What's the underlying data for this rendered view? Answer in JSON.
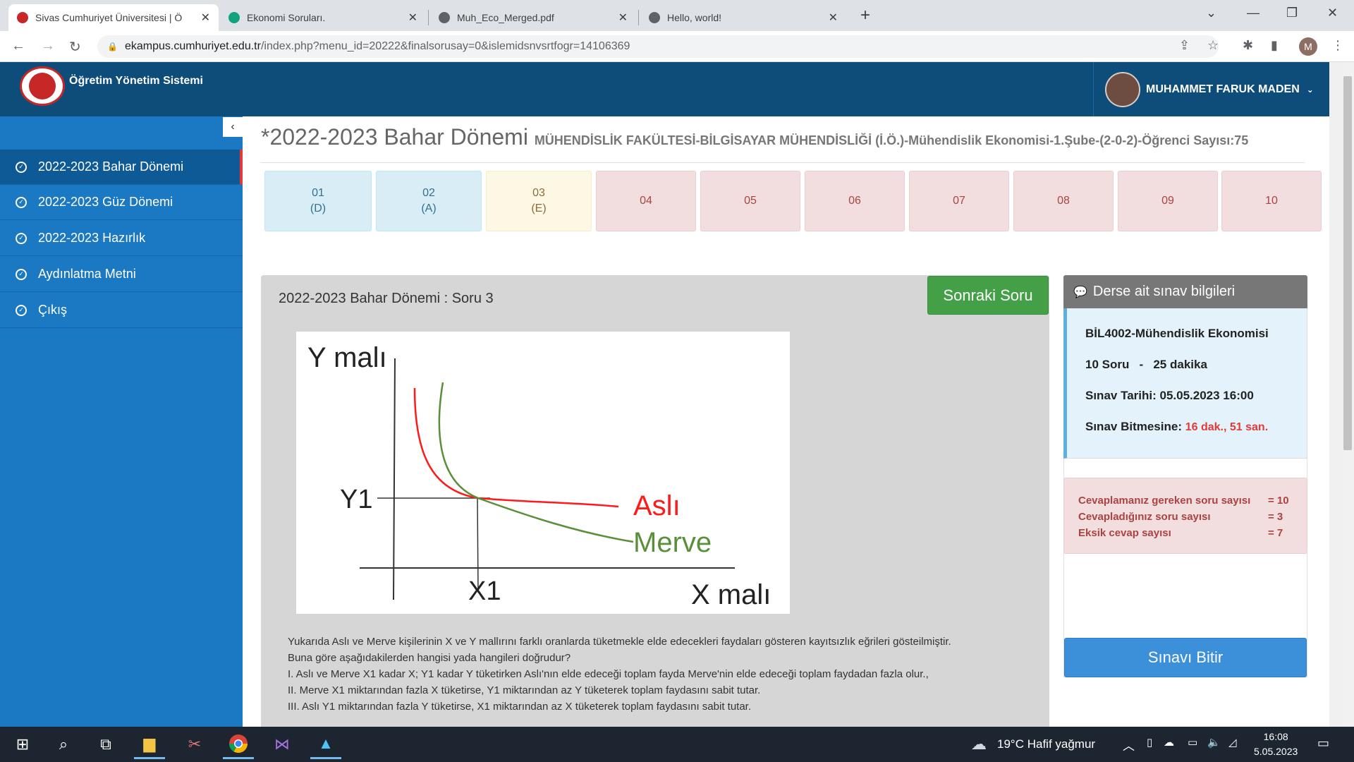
{
  "browser": {
    "tabs": [
      {
        "title": "Sivas Cumhuriyet Üniversitesi | Ö",
        "active": true,
        "favicon_color": "#c62828"
      },
      {
        "title": "Ekonomi Soruları.",
        "active": false,
        "favicon_color": "#10a37f"
      },
      {
        "title": "Muh_Eco_Merged.pdf",
        "active": false,
        "favicon_color": "#5f6368"
      },
      {
        "title": "Hello, world!",
        "active": false,
        "favicon_color": "#5f6368"
      }
    ],
    "url_host": "ekampus.cumhuriyet.edu.tr",
    "url_path": "/index.php?menu_id=20222&finalsorusay=0&islemidsnvsrtfogr=14106369",
    "profile_initial": "M"
  },
  "header": {
    "app_title": "Öğretim Yönetim Sistemi",
    "user_name": "MUHAMMET FARUK MADEN"
  },
  "sidebar": {
    "items": [
      {
        "label": "2022-2023 Bahar Dönemi",
        "active": true
      },
      {
        "label": "2022-2023 Güz Dönemi",
        "active": false
      },
      {
        "label": "2022-2023 Hazırlık",
        "active": false
      },
      {
        "label": "Aydınlatma Metni",
        "active": false
      },
      {
        "label": "Çıkış",
        "active": false
      }
    ]
  },
  "page": {
    "title": "*2022-2023 Bahar Dönemi",
    "subtitle": "MÜHENDİSLİK FAKÜLTESİ-BİLGİSAYAR MÜHENDİSLİĞİ (İ.Ö.)-Mühendislik Ekonomisi-1.Şube-(2-0-2)-Öğrenci Sayısı:75"
  },
  "question_nav": [
    {
      "num": "01",
      "answer": "(D)",
      "state": "answered"
    },
    {
      "num": "02",
      "answer": "(A)",
      "state": "answered"
    },
    {
      "num": "03",
      "answer": "(E)",
      "state": "current"
    },
    {
      "num": "04",
      "answer": "",
      "state": "pending"
    },
    {
      "num": "05",
      "answer": "",
      "state": "pending"
    },
    {
      "num": "06",
      "answer": "",
      "state": "pending"
    },
    {
      "num": "07",
      "answer": "",
      "state": "pending"
    },
    {
      "num": "08",
      "answer": "",
      "state": "pending"
    },
    {
      "num": "09",
      "answer": "",
      "state": "pending"
    },
    {
      "num": "10",
      "answer": "",
      "state": "pending"
    }
  ],
  "question": {
    "heading": "2022-2023 Bahar Dönemi : Soru 3",
    "next_label": "Sonraki Soru",
    "graph": {
      "y_axis_label": "Y malı",
      "x_axis_label": "X malı",
      "y_tick": "Y1",
      "x_tick": "X1",
      "curve_a_label": "Aslı",
      "curve_b_label": "Merve",
      "curve_a_color": "#ff1a1a",
      "curve_b_color": "#5a8f3a"
    },
    "lines": [
      "Yukarıda Aslı ve Merve kişilerinin X ve Y mallırını farklı oranlarda tüketmekle elde edecekleri faydaları gösteren kayıtsızlık eğrileri gösteilmiştir.",
      "Buna göre aşağıdakilerden hangisi yada hangileri doğrudur?",
      "I. Aslı ve Merve X1 kadar X; Y1 kadar Y tüketirken Aslı'nın elde edeceği toplam fayda Merve'nin elde edeceği toplam faydadan fazla olur.,",
      "II. Merve X1 miktarından fazla X tüketirse, Y1 miktarından az Y tüketerek toplam faydasını sabit tutar.",
      "III. Aslı Y1 miktarından fazla Y tüketirse, X1 miktarından  az X tüketerek toplam faydasını sabit tutar."
    ]
  },
  "exam_info": {
    "heading": "Derse ait sınav bilgileri",
    "course": "BİL4002-Mühendislik Ekonomisi",
    "summary": "10 Soru   -   25 dakika",
    "date_label": "Sınav Tarihi:",
    "date_value": "05.05.2023 16:00",
    "remaining_label": "Sınav Bitmesine:",
    "remaining_value": "16 dak., 51 san."
  },
  "counts": [
    {
      "label": "Cevaplamanız gereken soru sayısı",
      "value": "= 10"
    },
    {
      "label": "Cevapladığınız soru sayısı",
      "value": "= 3"
    },
    {
      "label": "Eksik cevap sayısı",
      "value": "= 7"
    }
  ],
  "finish_label": "Sınavı Bitir",
  "taskbar": {
    "weather": "19°C  Hafif yağmur",
    "time": "16:08",
    "date": "5.05.2023"
  }
}
